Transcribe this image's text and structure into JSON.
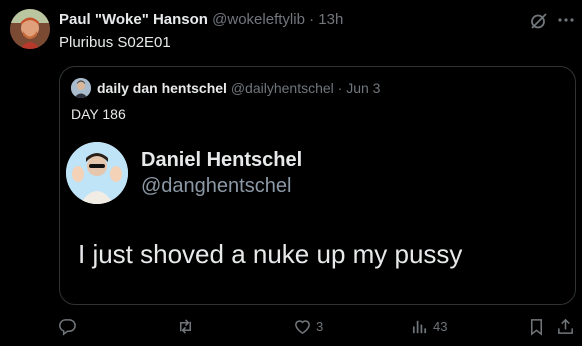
{
  "tweet": {
    "author_name": "Paul \"Woke\" Hanson",
    "author_handle": "@wokeleftylib",
    "separator": "·",
    "time": "13h",
    "text": "Pluribus S02E01"
  },
  "quote": {
    "author_name": "daily dan hentschel",
    "author_handle": "@dailyhentschel",
    "separator": "·",
    "date": "Jun 3",
    "text": "DAY 186",
    "inner": {
      "name": "Daniel Hentschel",
      "handle": "@danghentschel",
      "text": "I just shoved a nuke up my pussy"
    }
  },
  "actions": {
    "likes": "3",
    "views": "43"
  },
  "icons": [
    "grok-icon",
    "more-icon",
    "reply-icon",
    "retweet-icon",
    "like-icon",
    "views-icon",
    "bookmark-icon",
    "share-icon"
  ]
}
